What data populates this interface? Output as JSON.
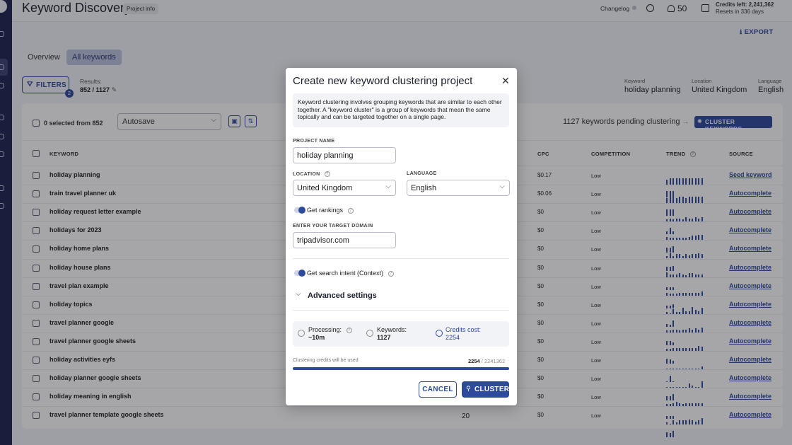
{
  "header": {
    "title": "Keyword Discovery",
    "project_info": "Project info",
    "changelog": "Changelog",
    "notifications": "50",
    "credits_left": "Credits left: 2,241,362",
    "credits_reset": "Resets in 336 days",
    "export": "EXPORT"
  },
  "tabs": [
    "Overview",
    "All keywords"
  ],
  "filters": {
    "label": "FILTERS",
    "badge": "2",
    "results_label": "Results:",
    "results_value": "852 / 1127"
  },
  "meta": [
    {
      "label": "Keyword",
      "value": "holiday planning"
    },
    {
      "label": "Location",
      "value": "United Kingdom"
    },
    {
      "label": "Language",
      "value": "English"
    }
  ],
  "toolbar": {
    "selected": "0 selected from 852",
    "view": "Autosave",
    "pending": "1127 keywords pending clustering",
    "cluster_keywords": "CLUSTER KEYWORDS"
  },
  "table": {
    "columns": {
      "keyword": "KEYWORD",
      "cpc": "CPC",
      "competition": "COMPETITION",
      "trend": "TREND",
      "source": "SOURCE"
    },
    "rows": [
      {
        "keyword": "holiday planning",
        "cpc": "$0.17",
        "competition": "Low",
        "source": "Seed keyword",
        "trend": [
          5,
          6,
          6,
          6,
          6,
          6,
          6,
          6,
          6,
          6,
          6,
          6,
          6,
          6,
          6
        ]
      },
      {
        "keyword": "train travel planner uk",
        "cpc": "$0.06",
        "competition": "Low",
        "source": "Autocomplete",
        "trend": [
          5,
          6,
          6,
          5,
          6,
          6,
          5,
          6,
          6,
          6,
          6,
          6,
          6,
          6,
          6
        ]
      },
      {
        "keyword": "holiday request letter example",
        "cpc": "$0",
        "competition": "Low",
        "source": "Autocomplete",
        "trend": [
          2,
          3,
          2,
          3,
          3,
          2,
          4,
          3,
          3,
          4,
          3,
          4,
          3,
          6,
          3
        ]
      },
      {
        "keyword": "holidays for 2023",
        "cpc": "$0",
        "competition": "Low",
        "source": "Autocomplete",
        "trend": [
          3,
          2,
          2,
          2,
          2,
          2,
          2,
          3,
          4,
          4,
          5,
          5,
          5,
          5,
          6
        ]
      },
      {
        "keyword": "holiday home plans",
        "cpc": "$0",
        "competition": "Low",
        "source": "Autocomplete",
        "trend": [
          2,
          5,
          2,
          4,
          4,
          2,
          4,
          3,
          4,
          4,
          5,
          4,
          4,
          4,
          5
        ]
      },
      {
        "keyword": "holiday house plans",
        "cpc": "$0",
        "competition": "Low",
        "source": "Autocomplete",
        "trend": [
          5,
          3,
          3,
          3,
          4,
          3,
          2,
          4,
          4,
          3,
          3,
          3,
          3,
          3,
          3
        ]
      },
      {
        "keyword": "travel plan example",
        "cpc": "$0",
        "competition": "Low",
        "source": "Autocomplete",
        "trend": [
          3,
          2,
          2,
          2,
          3,
          3,
          3,
          3,
          3,
          3,
          3,
          4,
          3,
          3,
          4
        ]
      },
      {
        "keyword": "holiday topics",
        "cpc": "$0",
        "competition": "Low",
        "source": "Autocomplete",
        "trend": [
          2,
          1,
          5,
          2,
          2,
          6,
          3,
          3,
          7,
          4,
          3,
          6,
          3,
          2,
          6
        ]
      },
      {
        "keyword": "travel planner google",
        "cpc": "$0",
        "competition": "Low",
        "source": "Autocomplete",
        "trend": [
          2,
          2,
          3,
          3,
          2,
          3,
          3,
          4,
          3,
          4,
          3,
          5,
          4,
          4,
          3
        ]
      },
      {
        "keyword": "travel planner google sheets",
        "cpc": "$0",
        "competition": "Low",
        "source": "Autocomplete",
        "trend": [
          2,
          2,
          3,
          3,
          3,
          3,
          3,
          3,
          3,
          3,
          5,
          4,
          5,
          4,
          3
        ]
      },
      {
        "keyword": "holiday activities eyfs",
        "cpc": "$0",
        "competition": "Low",
        "source": "Autocomplete",
        "trend": [
          1,
          1,
          1,
          1,
          1,
          1,
          1,
          1,
          1,
          1,
          1,
          3,
          1,
          6,
          1
        ]
      },
      {
        "keyword": "holiday planner google sheets",
        "cpc": "$0",
        "competition": "Low",
        "source": "Autocomplete",
        "trend": [
          1,
          1,
          1,
          1,
          1,
          1,
          1,
          4,
          2,
          1,
          1,
          6,
          4,
          4,
          6
        ]
      },
      {
        "keyword": "holiday meaning in english",
        "cpc": "$0",
        "competition": "Low",
        "source": "Autocomplete",
        "trend": [
          2,
          2,
          3,
          4,
          3,
          2,
          3,
          3,
          3,
          3,
          3,
          3,
          3,
          3,
          3
        ]
      },
      {
        "keyword": "travel planner template google sheets",
        "cpc": "$0",
        "competition": "Low",
        "source": "Autocomplete",
        "trend": [
          2,
          1,
          4,
          2,
          4,
          4,
          4,
          5,
          4,
          3,
          4,
          6,
          5,
          4,
          6
        ]
      }
    ],
    "visible_number": "20"
  },
  "modal": {
    "title": "Create new keyword clustering project",
    "info": "Keyword clustering involves grouping keywords that are similar to each other together. A \"keyword cluster\" is a group of keywords that mean the same topically and can be targeted together on a single page.",
    "project_name_label": "PROJECT NAME",
    "project_name_value": "holiday planning",
    "location_label": "LOCATION",
    "location_value": "United Kingdom",
    "language_label": "LANGUAGE",
    "language_value": "English",
    "get_rankings": "Get rankings",
    "target_domain_label": "ENTER YOUR TARGET DOMAIN",
    "target_domain_value": "tripadvisor.com",
    "search_intent": "Get search intent (Context)",
    "advanced": "Advanced settings",
    "processing_label": "Processing:",
    "processing_value": "~10m",
    "keywords_label": "Keywords:",
    "keywords_value": "1127",
    "cost_label": "Credits cost:",
    "cost_value": "2254",
    "credits_note": "Clustering credits will be used",
    "credits_used": "2254",
    "credits_total": "/ 2241362",
    "progress_fraction": 0.001,
    "cancel": "CANCEL",
    "cluster": "CLUSTER"
  },
  "colors": {
    "accent": "#2e4a9c",
    "sidebar": "#1d2552"
  }
}
